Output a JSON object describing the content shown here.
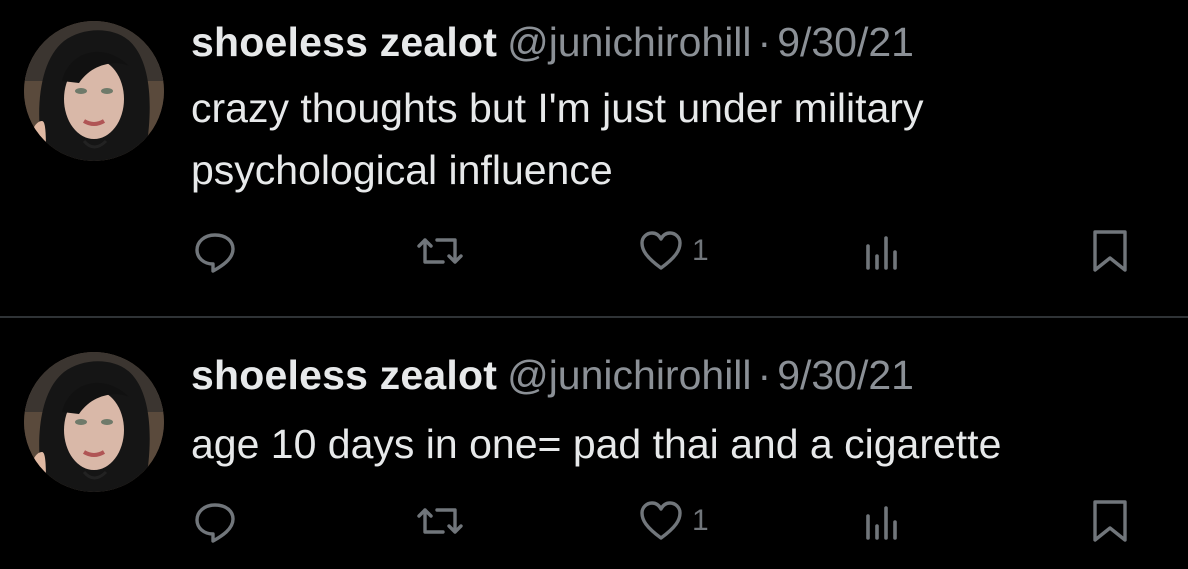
{
  "colors": {
    "background": "#000000",
    "text": "#e7e9ea",
    "secondary": "#8b9096",
    "icon": "#71767b",
    "divider": "#2f3336"
  },
  "tweets": [
    {
      "author_name": "shoeless zealot",
      "handle": "@junichirohill",
      "separator": "·",
      "date": "9/30/21",
      "text": "crazy thoughts but I'm just under military psychological influence",
      "actions": {
        "reply_icon": "reply-icon",
        "retweet_icon": "retweet-icon",
        "like_icon": "heart-icon",
        "like_count": "1",
        "views_icon": "analytics-icon",
        "bookmark_icon": "bookmark-icon"
      }
    },
    {
      "author_name": "shoeless zealot",
      "handle": "@junichirohill",
      "separator": "·",
      "date": "9/30/21",
      "text": "age 10 days in one= pad thai and a cigarette",
      "actions": {
        "reply_icon": "reply-icon",
        "retweet_icon": "retweet-icon",
        "like_icon": "heart-icon",
        "like_count": "1",
        "views_icon": "analytics-icon",
        "bookmark_icon": "bookmark-icon"
      }
    }
  ]
}
